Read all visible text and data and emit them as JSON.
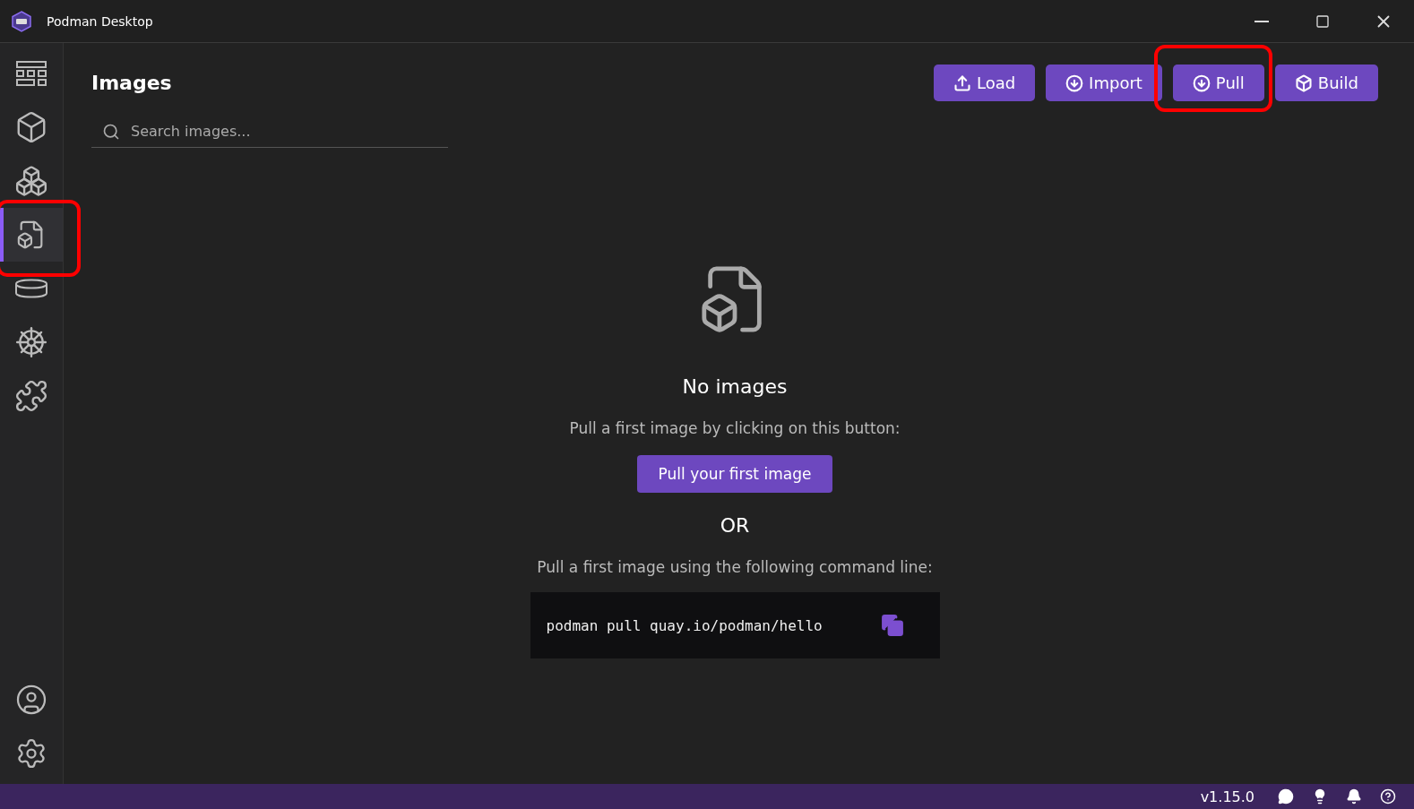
{
  "window": {
    "title": "Podman Desktop"
  },
  "sidebar": {
    "items": [
      {
        "kind": "dashboard",
        "selected": false,
        "highlighted": false
      },
      {
        "kind": "containers",
        "selected": false,
        "highlighted": false
      },
      {
        "kind": "pods",
        "selected": false,
        "highlighted": false
      },
      {
        "kind": "images",
        "selected": true,
        "highlighted": true
      },
      {
        "kind": "volumes",
        "selected": false,
        "highlighted": false
      },
      {
        "kind": "kubernetes",
        "selected": false,
        "highlighted": false
      },
      {
        "kind": "extensions",
        "selected": false,
        "highlighted": false
      }
    ],
    "bottom_items": [
      {
        "kind": "account"
      },
      {
        "kind": "settings"
      }
    ]
  },
  "page": {
    "title": "Images",
    "search": {
      "placeholder": "Search images..."
    },
    "actions": [
      {
        "kind": "load",
        "label": "Load",
        "highlighted": false
      },
      {
        "kind": "import",
        "label": "Import",
        "highlighted": false
      },
      {
        "kind": "pull",
        "label": "Pull",
        "highlighted": true
      },
      {
        "kind": "build",
        "label": "Build",
        "highlighted": false
      }
    ],
    "empty_state": {
      "title": "No images",
      "hint": "Pull a first image by clicking on this button:",
      "button": "Pull your first image",
      "separator": "OR",
      "command_hint": "Pull a first image using the following command line:",
      "command": "podman pull quay.io/podman/hello"
    }
  },
  "status_bar": {
    "version": "v1.15.0",
    "icons": [
      {
        "kind": "chat"
      },
      {
        "kind": "tips"
      },
      {
        "kind": "notifications"
      },
      {
        "kind": "help"
      }
    ]
  }
}
